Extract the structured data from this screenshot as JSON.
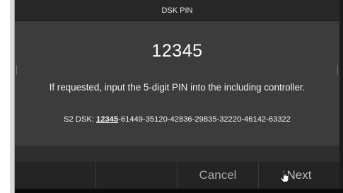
{
  "dialog": {
    "title": "DSK PIN",
    "pin": "12345",
    "instruction": "If requested, input the 5-digit PIN into the including controller.",
    "dsk_label": "S2 DSK: ",
    "dsk_key": "12345",
    "dsk_rest": "-61449-35120-42836-29835-32220-46142-63322"
  },
  "buttons": {
    "cancel": "Cancel",
    "next": "Next"
  },
  "icons": {
    "cursor": "hand-pointer-icon"
  },
  "colors": {
    "dialog_bg": "#3c3c3c",
    "titlebar_bg": "#282828",
    "button_bar_bg": "#242424",
    "text": "#f0f0f0",
    "button_text": "#a8a8a8"
  }
}
